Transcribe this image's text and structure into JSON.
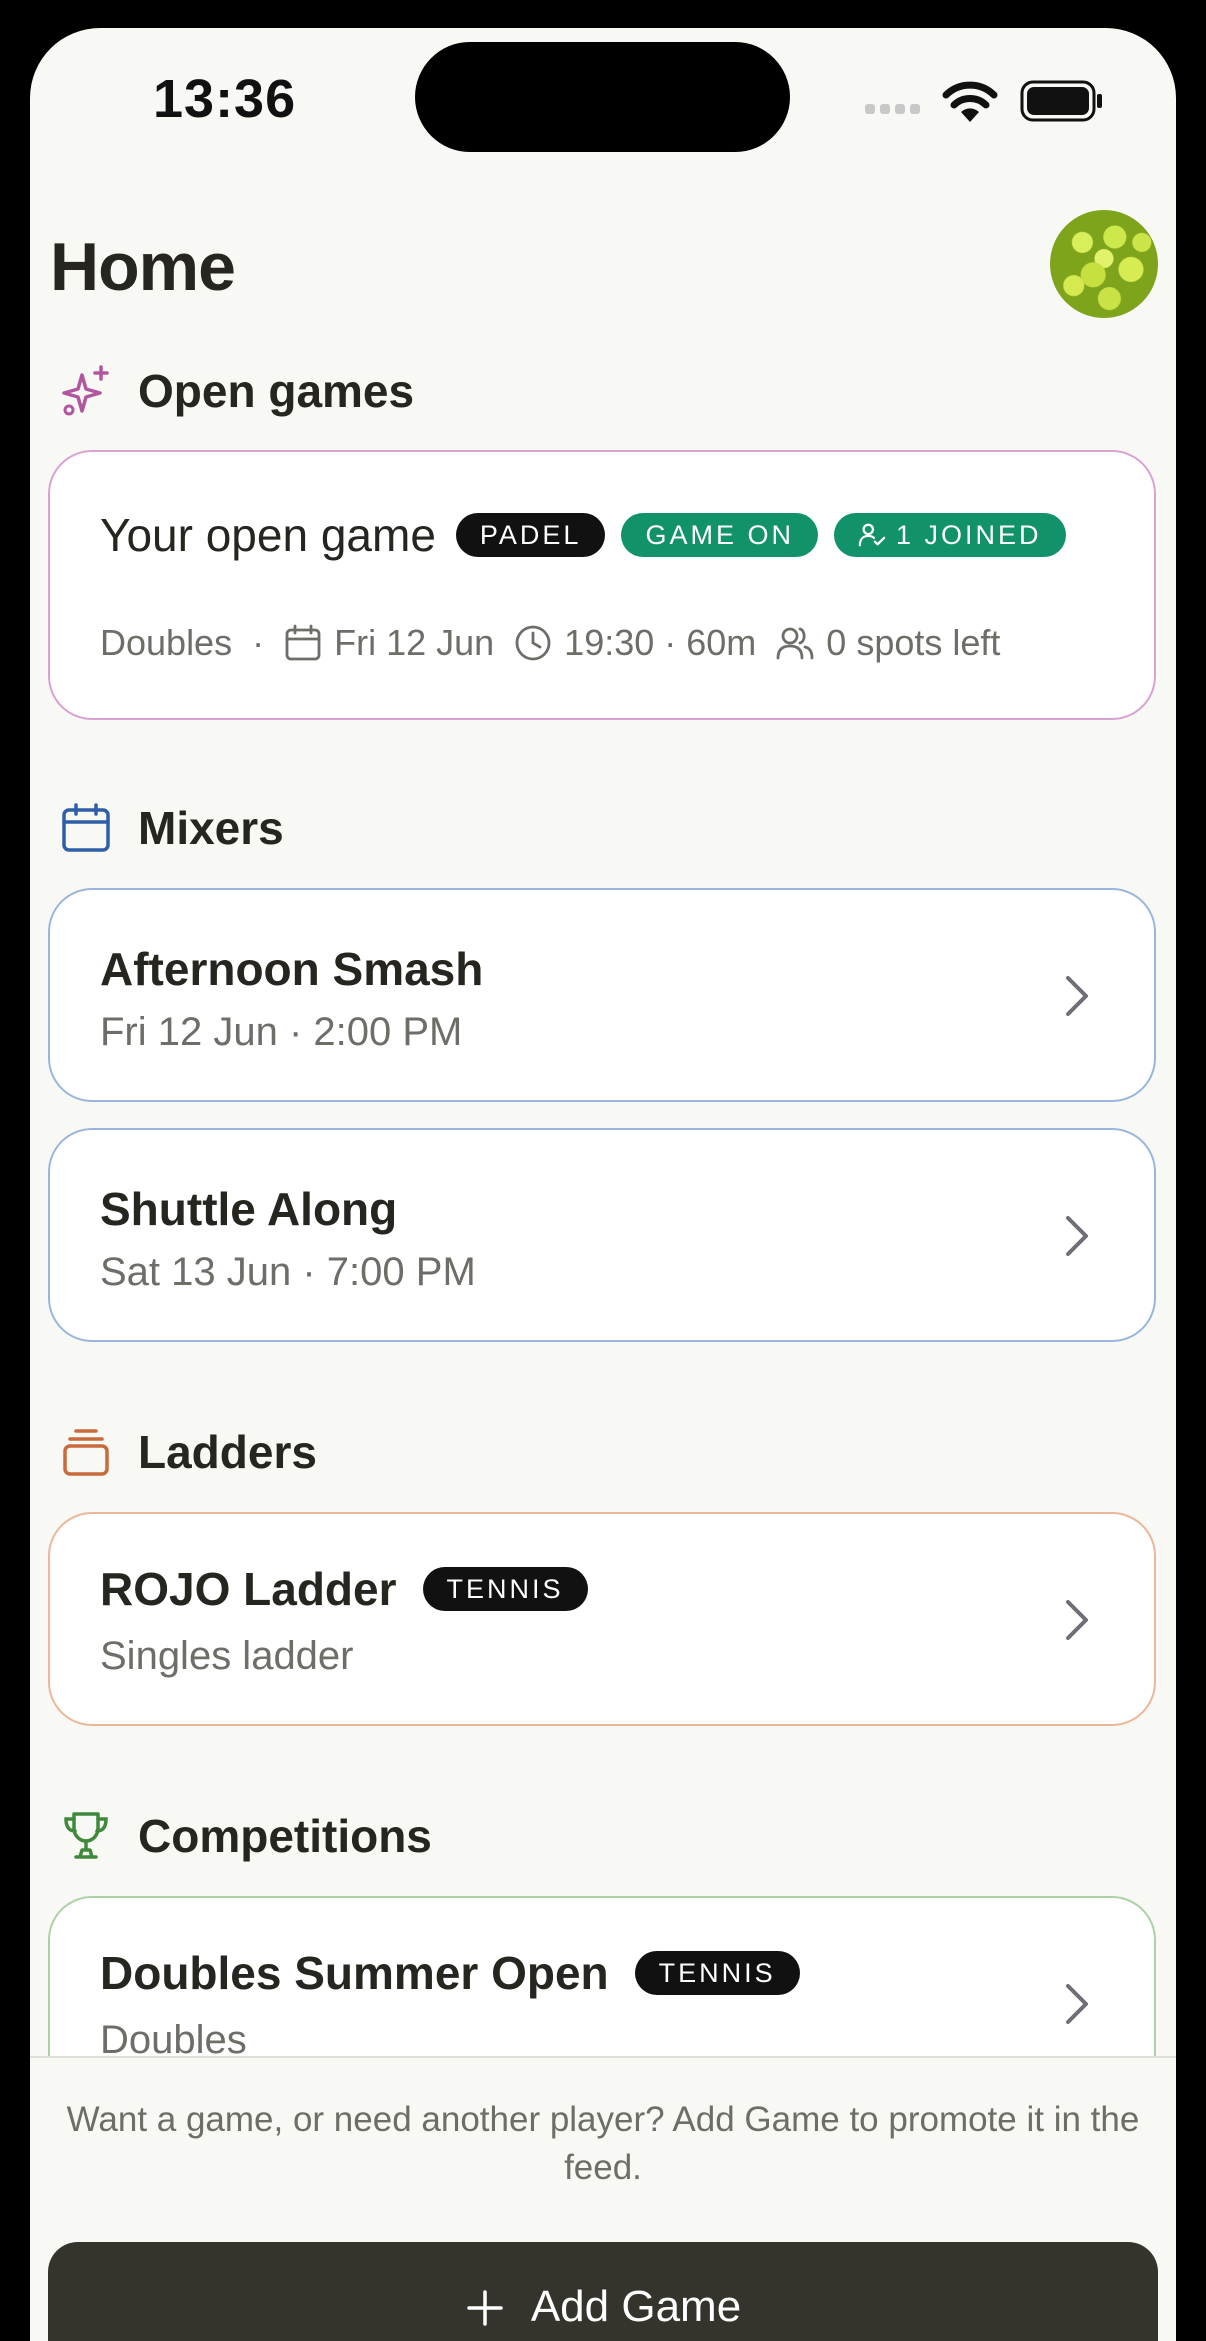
{
  "status_bar": {
    "time": "13:36"
  },
  "header": {
    "title": "Home"
  },
  "open_games": {
    "section_title": "Open games",
    "card": {
      "title": "Your open game",
      "sport": "PADEL",
      "status": "GAME ON",
      "joined": "1 JOINED",
      "format": "Doubles",
      "separator": "·",
      "date": "Fri 12 Jun",
      "time": "19:30 · 60m",
      "spots": "0 spots left"
    }
  },
  "mixers": {
    "section_title": "Mixers",
    "items": [
      {
        "title": "Afternoon Smash",
        "subtitle": "Fri 12 Jun · 2:00 PM"
      },
      {
        "title": "Shuttle Along",
        "subtitle": "Sat 13 Jun · 7:00 PM"
      }
    ]
  },
  "ladders": {
    "section_title": "Ladders",
    "items": [
      {
        "title": "ROJO Ladder",
        "tag": "TENNIS",
        "subtitle": "Singles ladder"
      }
    ]
  },
  "competitions": {
    "section_title": "Competitions",
    "items": [
      {
        "title": "Doubles Summer Open",
        "tag": "TENNIS",
        "subtitle": "Doubles"
      }
    ]
  },
  "footer": {
    "hint": "Want a game, or need another player? Add Game to promote it in the feed.",
    "add_button": "Add Game"
  },
  "colors": {
    "open_games_accent": "#c98ac6",
    "mixers_accent": "#8aa8d6",
    "ladders_accent": "#e0a07e",
    "competitions_accent": "#9ec694",
    "green_pill": "#12926b",
    "button_bg": "#34332c"
  },
  "icons": {
    "open_games": "sparkles-icon",
    "mixers": "calendar-icon",
    "ladders": "stack-icon",
    "competitions": "trophy-icon"
  }
}
